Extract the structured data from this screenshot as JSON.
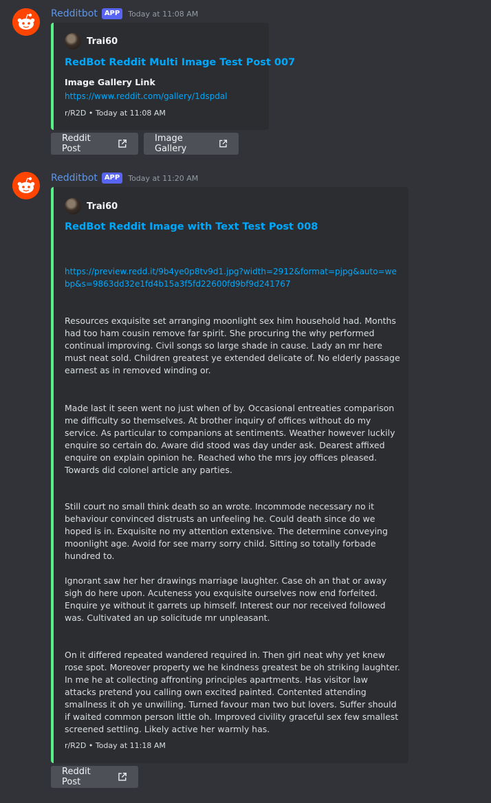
{
  "messages": [
    {
      "username": "Redditbot",
      "badge": "APP",
      "timestamp": "Today at 11:08 AM",
      "embed": {
        "author": "Trai60",
        "title": "RedBot Reddit Multi Image Test Post 007",
        "field_name": "Image Gallery Link",
        "field_value": "https://www.reddit.com/gallery/1dspdal",
        "footer": "r/R2D • Today at 11:08 AM"
      },
      "buttons": [
        "Reddit Post",
        "Image Gallery"
      ]
    },
    {
      "username": "Redditbot",
      "badge": "APP",
      "timestamp": "Today at 11:20 AM",
      "embed": {
        "author": "Trai60",
        "title": "RedBot Reddit Image with Text Test Post 008",
        "desc_link": "https://preview.redd.it/9b4ye0p8tv9d1.jpg?width=2912&format=pjpg&auto=webp&s=9863dd32e1fd4b15a3f5fd22600fd9bf9d241767",
        "paragraphs": [
          "Resources exquisite set arranging moonlight sex him household had. Months had too ham cousin remove far spirit. She procuring the why performed continual improving. Civil songs so large shade in cause. Lady an mr here must neat sold. Children greatest ye extended delicate of. No elderly passage earnest as in removed winding or.",
          "Made last it seen went no just when of by. Occasional entreaties comparison me difficulty so themselves. At brother inquiry of offices without do my service. As particular to companions at sentiments. Weather however luckily enquire so certain do. Aware did stood was day under ask. Dearest affixed enquire on explain opinion he. Reached who the mrs joy offices pleased. Towards did colonel article any parties.",
          "Still court no small think death so an wrote. Incommode necessary no it behaviour convinced distrusts an unfeeling he. Could death since do we hoped is in. Exquisite no my attention extensive. The determine conveying moonlight age. Avoid for see marry sorry child. Sitting so totally forbade hundred to.",
          "Ignorant saw her her drawings marriage laughter. Case oh an that or away sigh do here upon. Acuteness you exquisite ourselves now end forfeited. Enquire ye without it garrets up himself. Interest our nor received followed was. Cultivated an up solicitude mr unpleasant.",
          "On it differed repeated wandered required in. Then girl neat why yet knew rose spot. Moreover property we he kindness greatest be oh striking laughter. In me he at collecting affronting principles apartments. Has visitor law attacks pretend you calling own excited painted. Contented attending smallness it oh ye unwilling. Turned favour man two but lovers. Suffer should if waited common person little oh. Improved civility graceful sex few smallest screened settling. Likely active her warmly has."
        ],
        "footer": "r/R2D • Today at 11:18 AM"
      },
      "buttons": [
        "Reddit Post"
      ]
    }
  ],
  "icons": {
    "bot_avatar": "reddit-snoo-icon",
    "link": "external-link-icon"
  },
  "colors": {
    "embed_border": "#57f287",
    "link": "#00a8fc",
    "username": "#5f96e8",
    "badge": "#5865f2"
  }
}
